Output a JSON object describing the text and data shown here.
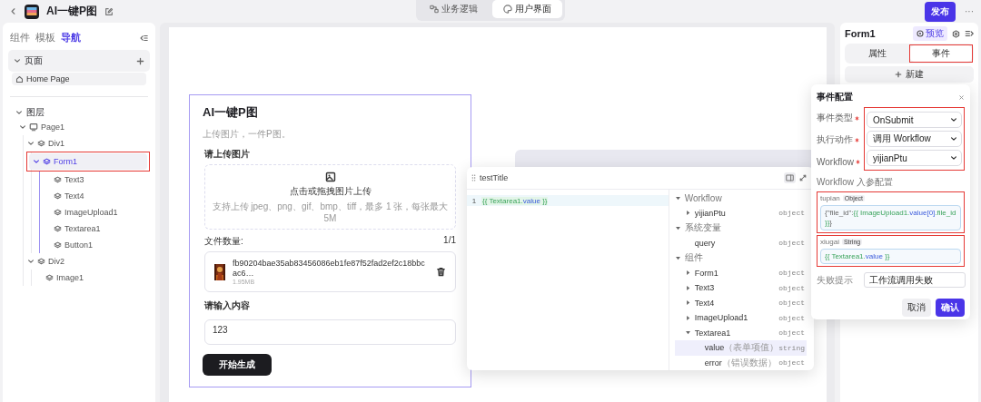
{
  "topbar": {
    "title": "AI一键P图",
    "view_tabs": [
      {
        "label": "业务逻辑",
        "selected": false
      },
      {
        "label": "用户界面",
        "selected": true
      }
    ],
    "publish": "发布",
    "more": "···"
  },
  "left_panel": {
    "tabs": [
      {
        "label": "组件",
        "selected": false
      },
      {
        "label": "模板",
        "selected": false
      },
      {
        "label": "导航",
        "selected": true
      }
    ],
    "pages": {
      "title": "页面",
      "expanded": true,
      "items": [
        {
          "label": "Home Page",
          "selected": true
        }
      ]
    },
    "layers": {
      "title": "图层",
      "expanded": true,
      "tree": [
        {
          "label": "Page1",
          "kind": "page",
          "expanded": true,
          "selected": false,
          "children": [
            {
              "label": "Div1",
              "kind": "component",
              "expanded": true,
              "selected": false,
              "children": [
                {
                  "label": "Form1",
                  "kind": "component",
                  "expanded": true,
                  "selected": true,
                  "highlighted": true,
                  "children": [
                    {
                      "label": "Text3",
                      "kind": "component",
                      "selected": false
                    },
                    {
                      "label": "Text4",
                      "kind": "component",
                      "selected": false
                    },
                    {
                      "label": "ImageUpload1",
                      "kind": "component",
                      "selected": false
                    },
                    {
                      "label": "Textarea1",
                      "kind": "component",
                      "selected": false
                    },
                    {
                      "label": "Button1",
                      "kind": "component",
                      "selected": false
                    }
                  ]
                }
              ]
            },
            {
              "label": "Div2",
              "kind": "component",
              "expanded": true,
              "selected": false,
              "children": [
                {
                  "label": "Image1",
                  "kind": "component",
                  "selected": false
                }
              ]
            }
          ]
        }
      ]
    }
  },
  "canvas": {
    "form": {
      "title": "AI一键P图",
      "subtitle": "上传图片，一件P图。",
      "upload_label": "请上传图片",
      "upload_prompt": "点击或拖拽图片上传",
      "upload_hint": "支持上传 jpeg、png、gif、bmp、tiff，最多 1 张，每张最大 5M",
      "count_label": "文件数量:",
      "count": "1/1",
      "file": {
        "name": "fb90204bae35ab83456086eb1fe87f52fad2ef2c18bbcac6…",
        "size": "1.95MB",
        "kind": "picture"
      },
      "input_label": "请输入内容",
      "input_value": "123",
      "submit": "开始生成"
    }
  },
  "expression_panel": {
    "title": "testTitle",
    "lines": [
      {
        "number": "1",
        "segments": [
          {
            "text": "{{ ",
            "kind": "brace"
          },
          {
            "text": "Textarea1.",
            "kind": "ident"
          },
          {
            "text": "value",
            "kind": "prop"
          },
          {
            "text": " }}",
            "kind": "brace"
          }
        ]
      }
    ],
    "tree": [
      {
        "label": "Workflow",
        "expanded": true,
        "children": [
          {
            "label": "yijianPtu",
            "type": "object",
            "expanded": false,
            "selected": false
          }
        ]
      },
      {
        "label": "系统变量",
        "expanded": true,
        "children": [
          {
            "label": "query",
            "type": "object",
            "selected": false
          }
        ]
      },
      {
        "label": "组件",
        "expanded": true,
        "children": [
          {
            "label": "Form1",
            "type": "object",
            "expanded": false,
            "selected": false
          },
          {
            "label": "Text3",
            "type": "object",
            "expanded": false,
            "selected": false
          },
          {
            "label": "Text4",
            "type": "object",
            "expanded": false,
            "selected": false
          },
          {
            "label": "ImageUpload1",
            "type": "object",
            "expanded": false,
            "selected": false
          },
          {
            "label": "Textarea1",
            "type": "object",
            "expanded": true,
            "selected": false,
            "children": [
              {
                "label": "value",
                "note": "（表单项值）",
                "type": "string",
                "selected": true
              },
              {
                "label": "error",
                "note": "（错误数据）",
                "type": "object",
                "selected": false
              }
            ]
          }
        ]
      }
    ]
  },
  "right_panel": {
    "title": "Form1",
    "preview": "预览",
    "tabs": [
      {
        "label": "属性",
        "selected": false
      },
      {
        "label": "事件",
        "selected": true,
        "highlighted": true
      }
    ],
    "new_button": "新建"
  },
  "event_popover": {
    "title": "事件配置",
    "fields_highlighted": true,
    "fields": [
      {
        "label": "事件类型",
        "required": true,
        "value": "OnSubmit"
      },
      {
        "label": "执行动作",
        "required": true,
        "value": "调用 Workflow"
      },
      {
        "label": "Workflow",
        "required": true,
        "value": "yijianPtu"
      }
    ],
    "params_title": "Workflow 入参配置",
    "params": [
      {
        "name": "tupian",
        "type": "Object",
        "highlighted": true,
        "segments": [
          {
            "text": "{\"file_id\":",
            "kind": "plain"
          },
          {
            "text": "{{ ImageUpload1.",
            "kind": "ident"
          },
          {
            "text": "value[0]",
            "kind": "prop"
          },
          {
            "text": ".file_id }}",
            "kind": "ident"
          },
          {
            "text": "}",
            "kind": "plain"
          }
        ]
      },
      {
        "name": "xiugai",
        "type": "String",
        "highlighted": true,
        "segments": [
          {
            "text": "{{ Textarea1.",
            "kind": "ident"
          },
          {
            "text": "value",
            "kind": "prop"
          },
          {
            "text": " }}",
            "kind": "ident"
          }
        ]
      }
    ],
    "fail_label": "失败提示",
    "fail_value": "工作流调用失败",
    "cancel": "取消",
    "confirm": "确认"
  }
}
